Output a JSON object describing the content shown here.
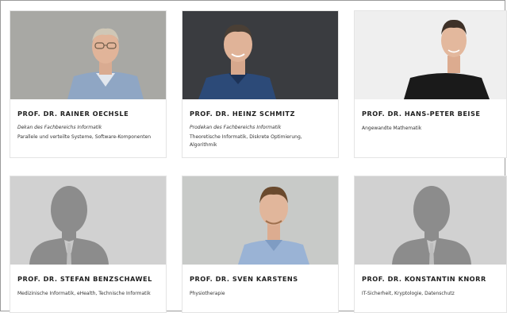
{
  "professors": [
    {
      "name": "PROF. DR. RAINER OECHSLE",
      "role": "Dekan des Fachbereichs Informatik",
      "areas": "Parallele und verteilte Systeme, Software-Komponenten",
      "photo": "portrait-photo",
      "photo_bg": "#a9a9a5"
    },
    {
      "name": "PROF. DR. HEINZ SCHMITZ",
      "role": "Prodekan des Fachbereichs Informatik",
      "areas": "Theoretische Informatik, Diskrete Optimierung, Algorithmik",
      "photo": "portrait-photo",
      "photo_bg": "#3a3c3f"
    },
    {
      "name": "PROF. DR. HANS-PETER BEISE",
      "role": "",
      "areas": "Angewandte Mathematik",
      "photo": "portrait-photo",
      "photo_bg": "#eeeeee"
    },
    {
      "name": "PROF. DR. STEFAN BENZSCHAWEL",
      "role": "",
      "areas": "Medizinische Informatik, eHealth, Technische Informatik",
      "photo": "placeholder-person-icon",
      "photo_bg": "#d0d0d0"
    },
    {
      "name": "PROF. DR. SVEN KARSTENS",
      "role": "",
      "areas": "Physiotherapie",
      "photo": "portrait-photo",
      "photo_bg": "#c7c9c7"
    },
    {
      "name": "PROF. DR. KONSTANTIN KNORR",
      "role": "",
      "areas": "IT-Sicherheit, Kryptologie, Datenschutz",
      "photo": "placeholder-person-icon",
      "photo_bg": "#d0d0d0"
    }
  ]
}
